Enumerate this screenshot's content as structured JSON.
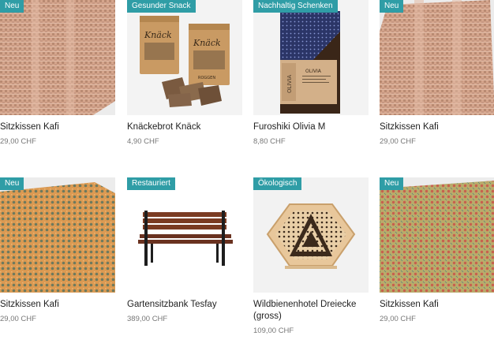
{
  "products": [
    {
      "badge": "Neu",
      "title": "Sitzkissen Kafi",
      "price": "29,00 CHF"
    },
    {
      "badge": "Gesunder Snack",
      "title": "Knäckebrot Knäck",
      "price": "4,90 CHF",
      "bag_label": "Knäck",
      "bag_sub": "ROGGEN"
    },
    {
      "badge": "Nachhaltig Schenken",
      "title": "Furoshiki Olivia M",
      "price": "8,80 CHF",
      "sleeve_label": "OLIVIA",
      "sleeve_brand": "SHOP"
    },
    {
      "badge": "Neu",
      "title": "Sitzkissen Kafi",
      "price": "29,00 CHF"
    },
    {
      "badge": "Neu",
      "title": "Sitzkissen Kafi",
      "price": "29,00 CHF"
    },
    {
      "badge": "Restauriert",
      "title": "Gartensitzbank Tesfay",
      "price": "389,00 CHF"
    },
    {
      "badge": "Ökologisch",
      "title": "Wildbienenhotel Dreiecke (gross)",
      "price": "109,00 CHF"
    },
    {
      "badge": "Neu",
      "title": "Sitzkissen Kafi",
      "price": "29,00 CHF"
    }
  ],
  "colors": {
    "badge": "#2f9da6",
    "weave_peach": "#d5a58c",
    "weave_orange": "#dc9a52",
    "weave_olive": "#b9ab6a"
  }
}
